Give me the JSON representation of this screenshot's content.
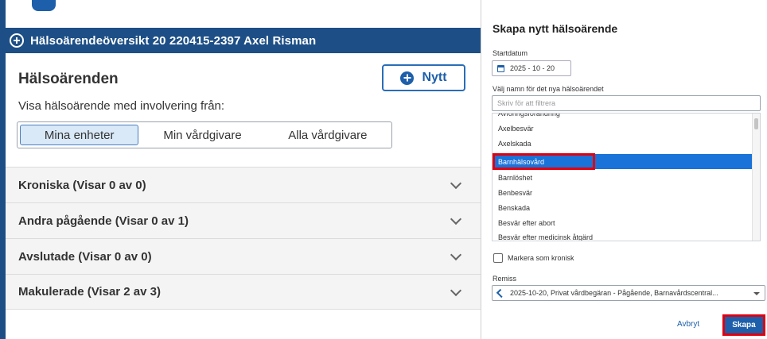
{
  "left_panel": {
    "title": "Hälsoärendeöversikt 20 220415-2397 Axel Risman",
    "heading": "Hälsoärenden",
    "new_button_label": "Nytt",
    "subtitle": "Visa hälsoärende med involvering från:",
    "segments": [
      {
        "label": "Mina enheter",
        "active": true
      },
      {
        "label": "Min vårdgivare",
        "active": false
      },
      {
        "label": "Alla vårdgivare",
        "active": false
      }
    ],
    "sections": [
      {
        "label": "Kroniska (Visar 0 av 0)"
      },
      {
        "label": "Andra pågående (Visar 0 av 1)"
      },
      {
        "label": "Avslutade (Visar 0 av 0)"
      },
      {
        "label": "Makulerade (Visar 2 av 3)"
      }
    ]
  },
  "dialog": {
    "title": "Skapa nytt hälsoärende",
    "start_date_label": "Startdatum",
    "start_date_value": "2025 - 10 - 20",
    "name_label": "Välj namn för det nya hälsoärendet",
    "filter_placeholder": "Skriv för att filtrera",
    "list_items": [
      "Avföringsförändring",
      "Axelbesvär",
      "Axelskada",
      "Barnhälsovård",
      "Barnlöshet",
      "Benbesvär",
      "Benskada",
      "Besvär efter abort",
      "Besvär efter medicinsk åtgärd"
    ],
    "selected_item": "Barnhälsovård",
    "chronic_checkbox_label": "Markera som kronisk",
    "referral_label": "Remiss",
    "referral_value": "2025-10-20, Privat vårdbegäran - Pågående, Barnavårdscentral...",
    "cancel_label": "Avbryt",
    "create_label": "Skapa"
  },
  "colors": {
    "brand_blue": "#1d4f86",
    "accent_blue": "#1d5faa",
    "selection_blue": "#1a73d9",
    "highlight_red": "#e0000f"
  }
}
